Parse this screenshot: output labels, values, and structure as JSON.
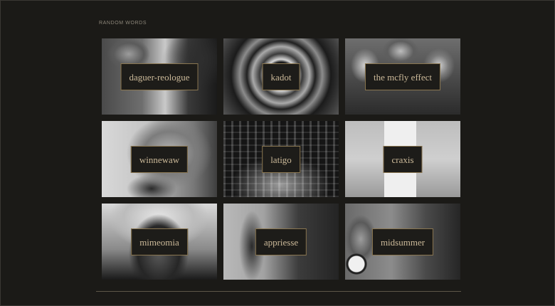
{
  "section": {
    "label": "RANDOM WORDS"
  },
  "tiles": [
    {
      "word": "daguer-reologue"
    },
    {
      "word": "kadot"
    },
    {
      "word": "the mcfly effect"
    },
    {
      "word": "winnewaw"
    },
    {
      "word": "latigo"
    },
    {
      "word": "craxis"
    },
    {
      "word": "mimeomia"
    },
    {
      "word": "appriesse"
    },
    {
      "word": "midsummer"
    }
  ]
}
